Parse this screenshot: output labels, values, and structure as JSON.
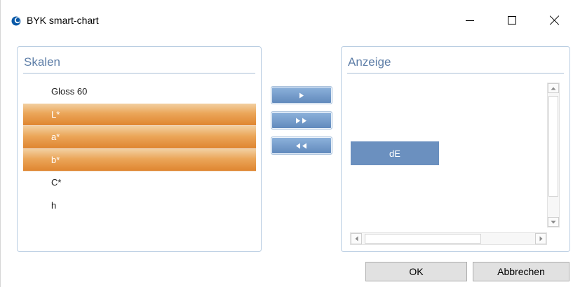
{
  "window": {
    "title": "BYK smart-chart",
    "icons": {
      "app": "byk-logo-icon",
      "minimize": "minimize-icon",
      "maximize": "maximize-icon",
      "close": "close-icon"
    }
  },
  "left_panel": {
    "title": "Skalen",
    "items": [
      {
        "label": "Gloss 60",
        "selected": false
      },
      {
        "label": "L*",
        "selected": true
      },
      {
        "label": "a*",
        "selected": true
      },
      {
        "label": "b*",
        "selected": true
      },
      {
        "label": "C*",
        "selected": false
      },
      {
        "label": "h",
        "selected": false
      }
    ]
  },
  "transfer_buttons": {
    "move": "triangle-right-icon",
    "move_all": "double-triangle-right-icon",
    "remove_all": "double-triangle-left-icon"
  },
  "right_panel": {
    "title": "Anzeige",
    "items": [
      {
        "label": "dE"
      }
    ]
  },
  "buttons": {
    "ok": "OK",
    "cancel": "Abbrechen"
  },
  "colors": {
    "accent": "#6b90bf",
    "panel_title": "#5f7fa8",
    "selected_top": "#f2cfa1",
    "selected_bottom": "#df8530"
  }
}
